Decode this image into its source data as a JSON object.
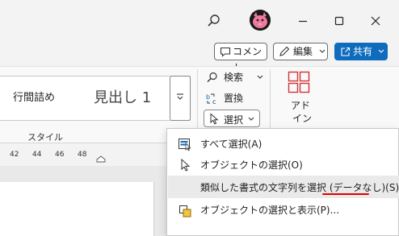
{
  "colors": {
    "accent": "#0f6cbd",
    "hover": "#eaeaea",
    "underline": "#e00000"
  },
  "titlebar": {
    "icons": [
      "search-icon",
      "avatar",
      "minimize-icon",
      "maximize-icon",
      "close-icon"
    ]
  },
  "top_buttons": {
    "comment": "コメント",
    "edit": "編集",
    "share": "共有"
  },
  "styles": {
    "items": [
      "行間詰め",
      "見出し 1"
    ],
    "group_label": "スタイル"
  },
  "editing": {
    "find": "検索",
    "replace": "置換",
    "select": "選択"
  },
  "addins": {
    "label_line1": "アド",
    "label_line2": "イン"
  },
  "ruler": {
    "ticks": [
      "42",
      "44",
      "46",
      "48"
    ]
  },
  "menu": {
    "items": [
      {
        "label": "すべて選択(A)",
        "icon": "select-all-icon"
      },
      {
        "label": "オブジェクトの選択(O)",
        "icon": "pointer-icon"
      },
      {
        "label": "類似した書式の文字列を選択 (データなし)(S)",
        "icon": "none"
      },
      {
        "label": "オブジェクトの選択と表示(P)...",
        "icon": "selection-pane-icon"
      }
    ]
  }
}
